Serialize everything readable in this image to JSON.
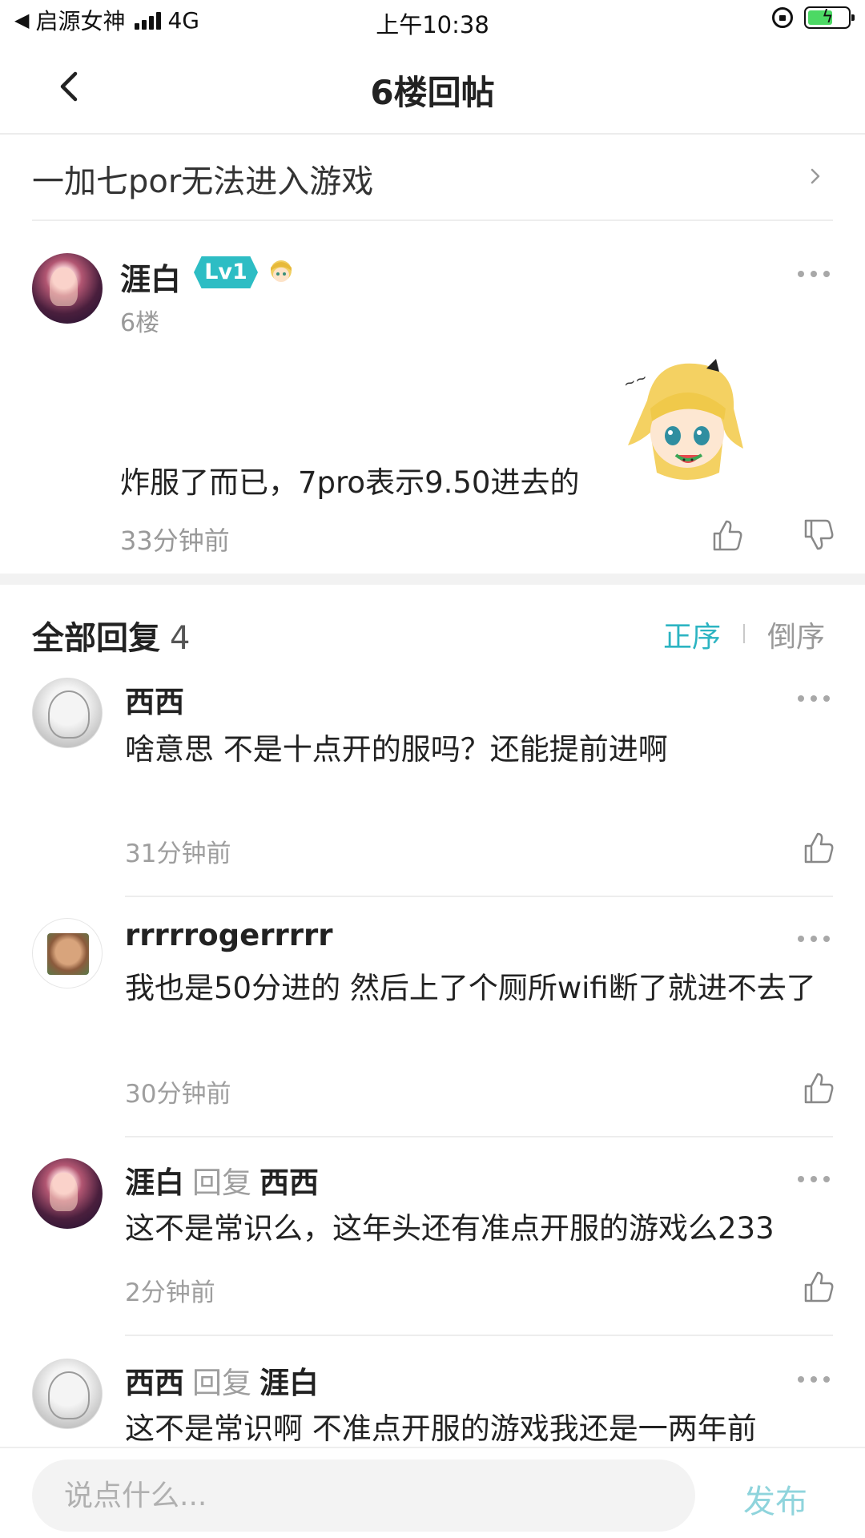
{
  "status_bar": {
    "carrier": "启源女神",
    "network": "4G",
    "time": "上午10:38"
  },
  "nav": {
    "title": "6楼回帖"
  },
  "thread": {
    "title": "一加七por无法进入游戏"
  },
  "post": {
    "author": "涯白",
    "level": "Lv1",
    "floor": "6楼",
    "text": "炸服了而已，7pro表示9.50进去的",
    "time": "33分钟前"
  },
  "replies": {
    "title": "全部回复",
    "count": "4",
    "sort_asc": "正序",
    "sort_desc": "倒序",
    "reply_word": "回复",
    "items": [
      {
        "author": "西西",
        "text": "啥意思 不是十点开的服吗？还能提前进啊",
        "time": "31分钟前"
      },
      {
        "author": "rrrrrogerrrrr",
        "text": "我也是50分进的 然后上了个厕所wifi断了就进不去了",
        "time": "30分钟前"
      },
      {
        "author": "涯白",
        "reply_to": "西西",
        "text": "这不是常识么，这年头还有准点开服的游戏么233",
        "time": "2分钟前"
      },
      {
        "author": "西西",
        "reply_to": "涯白",
        "text": "这不是常识啊 不准点开服的游戏我还是一两年前"
      }
    ]
  },
  "composer": {
    "placeholder": "说点什么...",
    "publish": "发布"
  },
  "colors": {
    "accent": "#2cb4c2",
    "level_badge": "#2dbdc4",
    "publish_disabled": "#8fd4dc",
    "meta_gray": "#9e9e9e"
  }
}
